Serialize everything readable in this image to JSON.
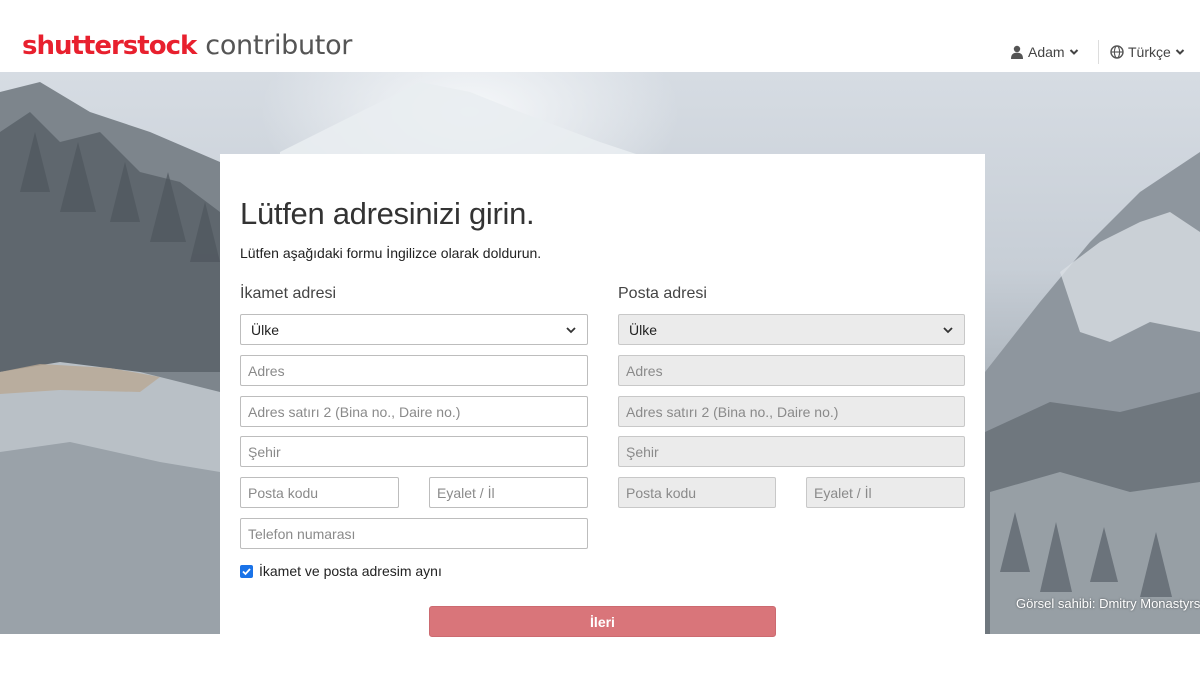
{
  "header": {
    "logo_brand": "shutterstock",
    "logo_product": "contributor",
    "user_label": "Adam",
    "language_label": "Türkçe"
  },
  "hero": {
    "credit": "Görsel sahibi: Dmitry Monastyrs"
  },
  "form": {
    "title": "Lütfen adresinizi girin.",
    "subtitle": "Lütfen aşağıdaki formu İngilizce olarak doldurun.",
    "residence": {
      "heading": "İkamet adresi",
      "country_value": "Ülke",
      "address_placeholder": "Adres",
      "address2_placeholder": "Adres satırı 2 (Bina no., Daire no.)",
      "city_placeholder": "Şehir",
      "postal_placeholder": "Posta kodu",
      "state_placeholder": "Eyalet / İl",
      "phone_placeholder": "Telefon numarası"
    },
    "mailing": {
      "heading": "Posta adresi",
      "country_value": "Ülke",
      "address_placeholder": "Adres",
      "address2_placeholder": "Adres satırı 2 (Bina no., Daire no.)",
      "city_placeholder": "Şehir",
      "postal_placeholder": "Posta kodu",
      "state_placeholder": "Eyalet / İl"
    },
    "same_address_label": "İkamet ve posta adresim aynı",
    "same_address_checked": true,
    "next_button": "İleri"
  },
  "colors": {
    "brand_red": "#e8202e",
    "button": "#d9757a",
    "checkbox": "#1a73e8"
  }
}
